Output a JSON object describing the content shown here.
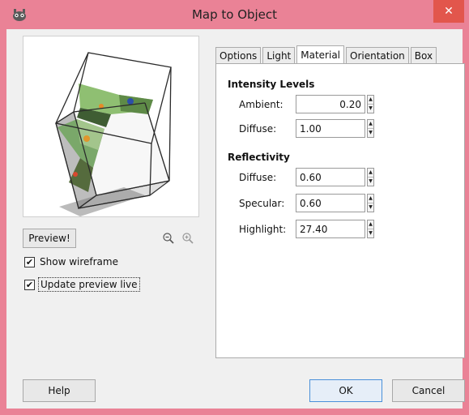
{
  "window": {
    "title": "Map to Object",
    "close_glyph": "✕"
  },
  "preview": {
    "button_label": "Preview!",
    "zoom_out_icon": "zoom-out-icon",
    "zoom_in_icon": "zoom-in-icon"
  },
  "options": {
    "show_wireframe": {
      "label": "Show wireframe",
      "checked": true
    },
    "update_preview_live": {
      "label": "Update preview live",
      "checked": true
    }
  },
  "tabs": [
    {
      "label": "Options",
      "active": false
    },
    {
      "label": "Light",
      "active": false
    },
    {
      "label": "Material",
      "active": true
    },
    {
      "label": "Orientation",
      "active": false
    },
    {
      "label": "Box",
      "active": false
    }
  ],
  "material": {
    "intensity_title": "Intensity Levels",
    "ambient": {
      "label": "Ambient:",
      "value": "0.20"
    },
    "diffuse": {
      "label": "Diffuse:",
      "value": "1.00"
    },
    "reflectivity_title": "Reflectivity",
    "refl_diffuse": {
      "label": "Diffuse:",
      "value": "0.60"
    },
    "specular": {
      "label": "Specular:",
      "value": "0.60"
    },
    "highlight": {
      "label": "Highlight:",
      "value": "27.40"
    }
  },
  "buttons": {
    "help": "Help",
    "ok": "OK",
    "cancel": "Cancel"
  },
  "colors": {
    "titlebar": "#ea8296",
    "close": "#e2564c"
  }
}
